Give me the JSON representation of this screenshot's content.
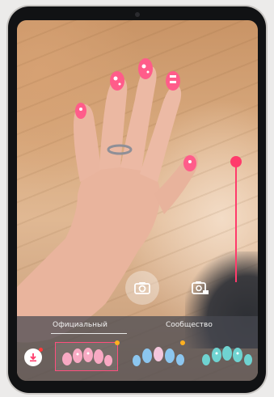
{
  "tabs": {
    "official": "Официальный",
    "community": "Сообщество",
    "active": "official"
  },
  "filter_intensity": 1.0,
  "icons": {
    "shutter": "camera-icon",
    "gallery": "gallery-icon",
    "save": "download-icon",
    "hand": "hand-icon",
    "nail_thumbnail": "nail-thumbnail-icon"
  },
  "colors": {
    "accent": "#ff3b6b",
    "nail_pink": "#ff5c8a",
    "thumb_pink": "#f8a9c3",
    "thumb_blue": "#8cc6ef",
    "thumb_teal": "#6fd3d1",
    "new_badge": "#ffb020"
  },
  "designs": [
    {
      "style": "pink",
      "selected": true,
      "badge": true
    },
    {
      "style": "blue",
      "selected": false,
      "badge": true
    },
    {
      "style": "teal",
      "selected": false,
      "badge": false
    }
  ]
}
